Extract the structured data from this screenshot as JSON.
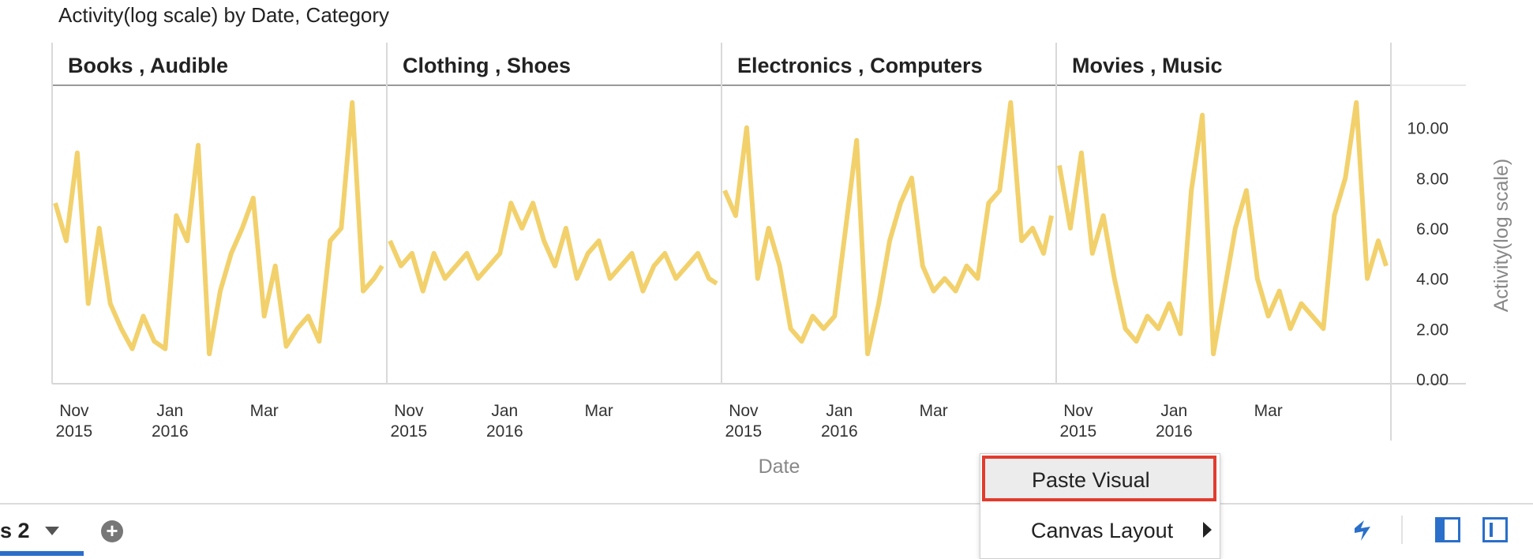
{
  "chart_data": {
    "type": "line",
    "title": "Activity(log scale) by Date, Category",
    "xlabel": "Date",
    "ylabel": "Activity(log scale)",
    "ylim": [
      0,
      11.5
    ],
    "yticks": [
      "0.00",
      "2.00",
      "4.00",
      "6.00",
      "8.00",
      "10.00"
    ],
    "xlim": [
      "2015-10-20",
      "2016-05-15"
    ],
    "xticks": [
      {
        "date": "2015-11-01",
        "line1": "Nov",
        "line2": "2015"
      },
      {
        "date": "2016-01-01",
        "line1": "Jan",
        "line2": "2016"
      },
      {
        "date": "2016-03-01",
        "line1": "Mar",
        "line2": ""
      }
    ],
    "line_color": "#f2d16c",
    "facets": [
      {
        "name": "Books , Audible",
        "x": [
          "2015-10-20",
          "2015-10-27",
          "2015-11-03",
          "2015-11-10",
          "2015-11-17",
          "2015-11-24",
          "2015-12-01",
          "2015-12-08",
          "2015-12-15",
          "2015-12-22",
          "2015-12-29",
          "2016-01-05",
          "2016-01-12",
          "2016-01-19",
          "2016-01-26",
          "2016-02-02",
          "2016-02-09",
          "2016-02-16",
          "2016-02-23",
          "2016-03-01",
          "2016-03-08",
          "2016-03-15",
          "2016-03-22",
          "2016-03-29",
          "2016-04-05",
          "2016-04-12",
          "2016-04-19",
          "2016-04-26",
          "2016-05-03",
          "2016-05-10",
          "2016-05-15"
        ],
        "y": [
          7.0,
          5.5,
          9.0,
          3.0,
          6.0,
          3.0,
          2.0,
          1.2,
          2.5,
          1.5,
          1.2,
          6.5,
          5.5,
          9.3,
          1.0,
          3.5,
          5.0,
          6.0,
          7.2,
          2.5,
          4.5,
          1.3,
          2.0,
          2.5,
          1.5,
          5.5,
          6.0,
          11.0,
          3.5,
          4.0,
          4.5
        ]
      },
      {
        "name": "Clothing , Shoes",
        "x": [
          "2015-10-20",
          "2015-10-27",
          "2015-11-03",
          "2015-11-10",
          "2015-11-17",
          "2015-11-24",
          "2015-12-01",
          "2015-12-08",
          "2015-12-15",
          "2015-12-22",
          "2015-12-29",
          "2016-01-05",
          "2016-01-12",
          "2016-01-19",
          "2016-01-26",
          "2016-02-02",
          "2016-02-09",
          "2016-02-16",
          "2016-02-23",
          "2016-03-01",
          "2016-03-08",
          "2016-03-15",
          "2016-03-22",
          "2016-03-29",
          "2016-04-05",
          "2016-04-12",
          "2016-04-19",
          "2016-04-26",
          "2016-05-03",
          "2016-05-10",
          "2016-05-15"
        ],
        "y": [
          5.5,
          4.5,
          5.0,
          3.5,
          5.0,
          4.0,
          4.5,
          5.0,
          4.0,
          4.5,
          5.0,
          7.0,
          6.0,
          7.0,
          5.5,
          4.5,
          6.0,
          4.0,
          5.0,
          5.5,
          4.0,
          4.5,
          5.0,
          3.5,
          4.5,
          5.0,
          4.0,
          4.5,
          5.0,
          4.0,
          3.8
        ]
      },
      {
        "name": "Electronics , Computers",
        "x": [
          "2015-10-20",
          "2015-10-27",
          "2015-11-03",
          "2015-11-10",
          "2015-11-17",
          "2015-11-24",
          "2015-12-01",
          "2015-12-08",
          "2015-12-15",
          "2015-12-22",
          "2015-12-29",
          "2016-01-05",
          "2016-01-12",
          "2016-01-19",
          "2016-01-26",
          "2016-02-02",
          "2016-02-09",
          "2016-02-16",
          "2016-02-23",
          "2016-03-01",
          "2016-03-08",
          "2016-03-15",
          "2016-03-22",
          "2016-03-29",
          "2016-04-05",
          "2016-04-12",
          "2016-04-19",
          "2016-04-26",
          "2016-05-03",
          "2016-05-10",
          "2016-05-15"
        ],
        "y": [
          7.5,
          6.5,
          10.0,
          4.0,
          6.0,
          4.5,
          2.0,
          1.5,
          2.5,
          2.0,
          2.5,
          6.0,
          9.5,
          1.0,
          3.0,
          5.5,
          7.0,
          8.0,
          4.5,
          3.5,
          4.0,
          3.5,
          4.5,
          4.0,
          7.0,
          7.5,
          11.0,
          5.5,
          6.0,
          5.0,
          6.5
        ]
      },
      {
        "name": "Movies , Music",
        "x": [
          "2015-10-20",
          "2015-10-27",
          "2015-11-03",
          "2015-11-10",
          "2015-11-17",
          "2015-11-24",
          "2015-12-01",
          "2015-12-08",
          "2015-12-15",
          "2015-12-22",
          "2015-12-29",
          "2016-01-05",
          "2016-01-12",
          "2016-01-19",
          "2016-01-26",
          "2016-02-02",
          "2016-02-09",
          "2016-02-16",
          "2016-02-23",
          "2016-03-01",
          "2016-03-08",
          "2016-03-15",
          "2016-03-22",
          "2016-03-29",
          "2016-04-05",
          "2016-04-12",
          "2016-04-19",
          "2016-04-26",
          "2016-05-03",
          "2016-05-10",
          "2016-05-15"
        ],
        "y": [
          8.5,
          6.0,
          9.0,
          5.0,
          6.5,
          4.0,
          2.0,
          1.5,
          2.5,
          2.0,
          3.0,
          1.8,
          7.5,
          10.5,
          1.0,
          3.5,
          6.0,
          7.5,
          4.0,
          2.5,
          3.5,
          2.0,
          3.0,
          2.5,
          2.0,
          6.5,
          8.0,
          11.0,
          4.0,
          5.5,
          4.5
        ]
      }
    ]
  },
  "bottom_bar": {
    "sheet_tab_label": "s 2",
    "add_sheet_label": "+"
  },
  "context_menu": {
    "items": [
      {
        "label": "Paste Visual",
        "highlighted": true
      },
      {
        "label": "Canvas Layout",
        "has_submenu": true
      }
    ]
  }
}
